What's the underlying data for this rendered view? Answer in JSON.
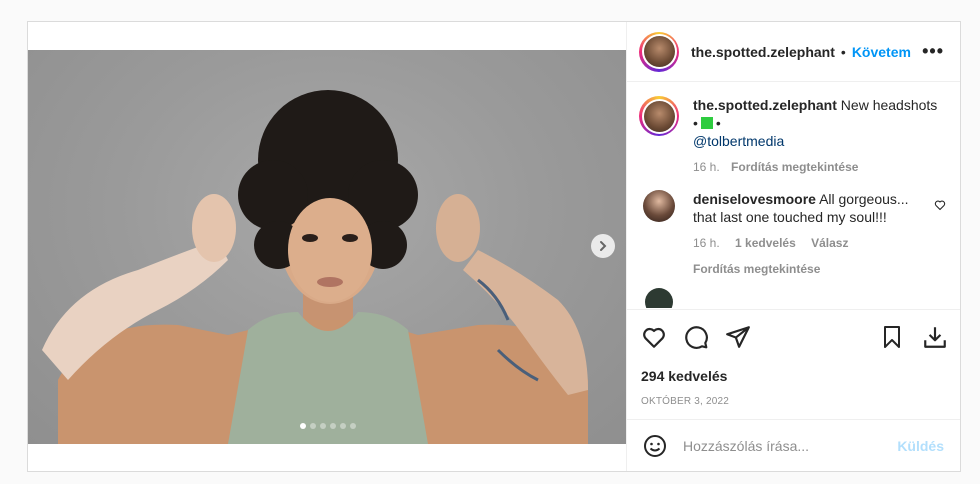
{
  "post": {
    "author": {
      "username": "the.spotted.zelephant",
      "separator": "•",
      "follow_label": "Követem",
      "more_label": "•••"
    },
    "caption": {
      "username": "the.spotted.zelephant",
      "text": "New headshots",
      "emoji_prefix": "•",
      "emoji_suffix": "•",
      "mention": "@tolbertmedia",
      "time": "16 h.",
      "translate_label": "Fordítás megtekintése"
    },
    "comments": [
      {
        "username": "deniselovesmoore",
        "text": "All gorgeous... that last one touched my soul!!!",
        "time": "16 h.",
        "likes": "1 kedvelés",
        "reply_label": "Válasz",
        "translate_label": "Fordítás megtekintése"
      }
    ],
    "likes_text": "294 kedvelés",
    "date_text": "OKTÓBER 3, 2022",
    "comment_input": {
      "placeholder": "Hozzászólás írása..."
    },
    "send_label": "Küldés",
    "carousel": {
      "slide_count": 6,
      "active_index": 0
    }
  },
  "icons": [
    "more-icon",
    "chevron-right-icon",
    "heart-icon",
    "comment-icon",
    "share-icon",
    "bookmark-icon",
    "download-icon",
    "emoji-icon",
    "heart-small-icon"
  ],
  "colors": {
    "accent": "#0095f6",
    "send_disabled": "#b2dffc",
    "muted": "#8e8e8e"
  }
}
